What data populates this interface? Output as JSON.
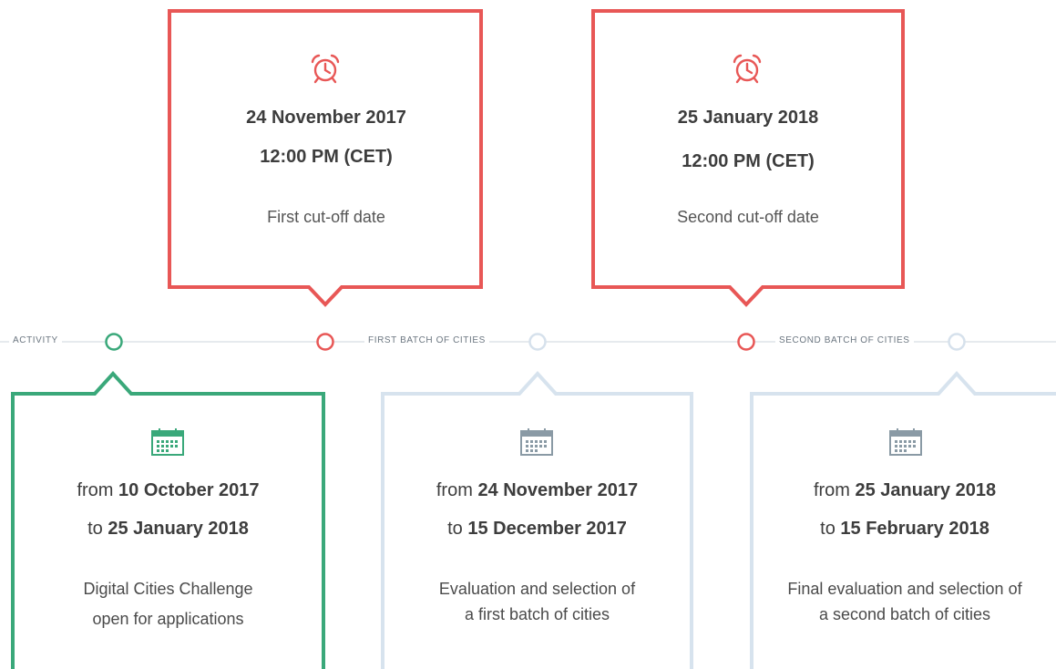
{
  "colors": {
    "deadline_red": "#e85756",
    "active_green": "#3aa87a",
    "inactive_blue": "#d7e3ee",
    "timeline_line": "#d9dfe4",
    "calendar_inactive": "#8a9aa5"
  },
  "cutoffs": [
    {
      "icon": "alarm-clock-icon",
      "date": "24 November 2017",
      "time": "12:00 PM (CET)",
      "description": "First cut-off date"
    },
    {
      "icon": "alarm-clock-icon",
      "date": "25 January 2018",
      "time": "12:00 PM (CET)",
      "description": "Second cut-off date"
    }
  ],
  "timeline": {
    "labels": [
      "ACTIVITY",
      "FIRST BATCH OF CITIES",
      "SECOND BATCH OF CITIES"
    ]
  },
  "phases": [
    {
      "status": "active",
      "icon": "calendar-icon",
      "from_word": "from",
      "from_date": "10 October 2017",
      "to_word": "to",
      "to_date": "25 January 2018",
      "description_line1": "Digital Cities Challenge",
      "description_line2": "open for applications"
    },
    {
      "status": "upcoming",
      "icon": "calendar-icon",
      "from_word": "from",
      "from_date": "24 November 2017",
      "to_word": "to",
      "to_date": "15 December 2017",
      "description_line1": "Evaluation and selection of",
      "description_line2": "a first batch of cities"
    },
    {
      "status": "upcoming",
      "icon": "calendar-icon",
      "from_word": "from",
      "from_date": "25 January 2018",
      "to_word": "to",
      "to_date": "15 February 2018",
      "description_line1": "Final evaluation and selection of",
      "description_line2": "a second batch of cities"
    }
  ]
}
